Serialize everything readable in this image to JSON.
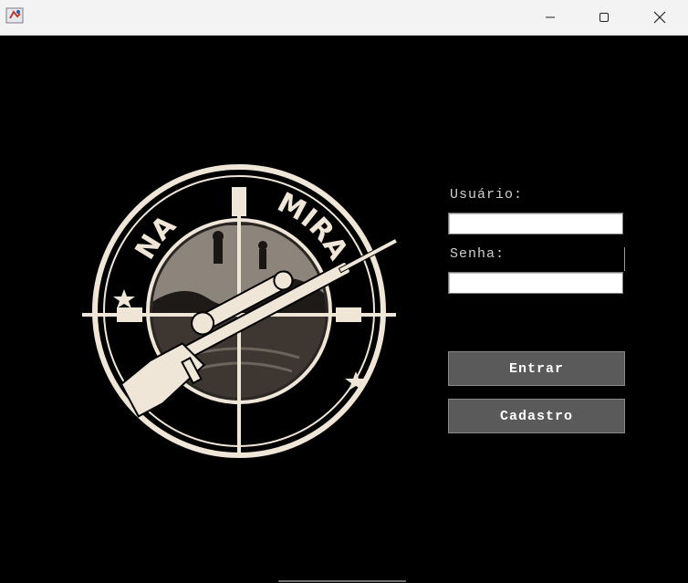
{
  "window": {
    "controls": {
      "minimize_icon": "minimize-icon",
      "maximize_icon": "maximize-icon",
      "close_icon": "close-icon"
    }
  },
  "logo": {
    "text_left": "NA",
    "text_right": "MIRA"
  },
  "login": {
    "username_label": "Usuário:",
    "username_value": "",
    "password_label": "Senha:",
    "password_value": "",
    "enter_button": "Entrar",
    "register_button": "Cadastro"
  },
  "colors": {
    "background": "#000000",
    "button": "#5a5a5a",
    "logo_cream": "#efe6d8"
  }
}
